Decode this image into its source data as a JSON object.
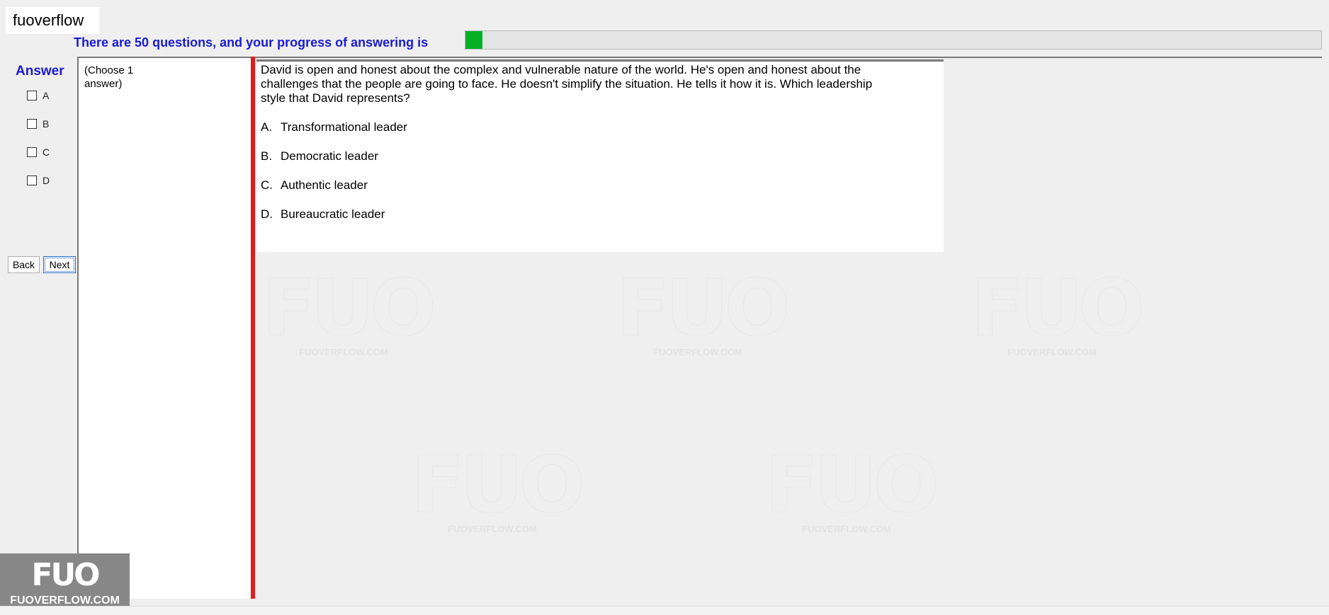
{
  "app": {
    "label": "fuoverflow"
  },
  "progress": {
    "text": "There are 50 questions, and your progress of answering is",
    "value_percent": 2,
    "fill_color": "#06b025"
  },
  "answer_panel": {
    "title": "Answer",
    "options": [
      "A",
      "B",
      "C",
      "D"
    ]
  },
  "nav": {
    "back_label": "Back",
    "next_label": "Next"
  },
  "instruction": {
    "text": "(Choose 1 answer)"
  },
  "question": {
    "text": "David is open and honest about the complex and vulnerable nature of the world. He's open and honest about the challenges that the people are going to face. He doesn't simplify the situation. He tells it how it is. Which leadership style that David represents?",
    "choices": [
      {
        "letter": "A.",
        "text": "Transformational leader"
      },
      {
        "letter": "B.",
        "text": "Democratic leader"
      },
      {
        "letter": "C.",
        "text": "Authentic leader"
      },
      {
        "letter": "D.",
        "text": "Bureaucratic leader"
      }
    ]
  },
  "watermark": {
    "logo": "FUO",
    "site": "FUOVERFLOW.COM"
  },
  "colors": {
    "accent_blue": "#1a1ad6",
    "splitter_red": "#e31b1b"
  }
}
